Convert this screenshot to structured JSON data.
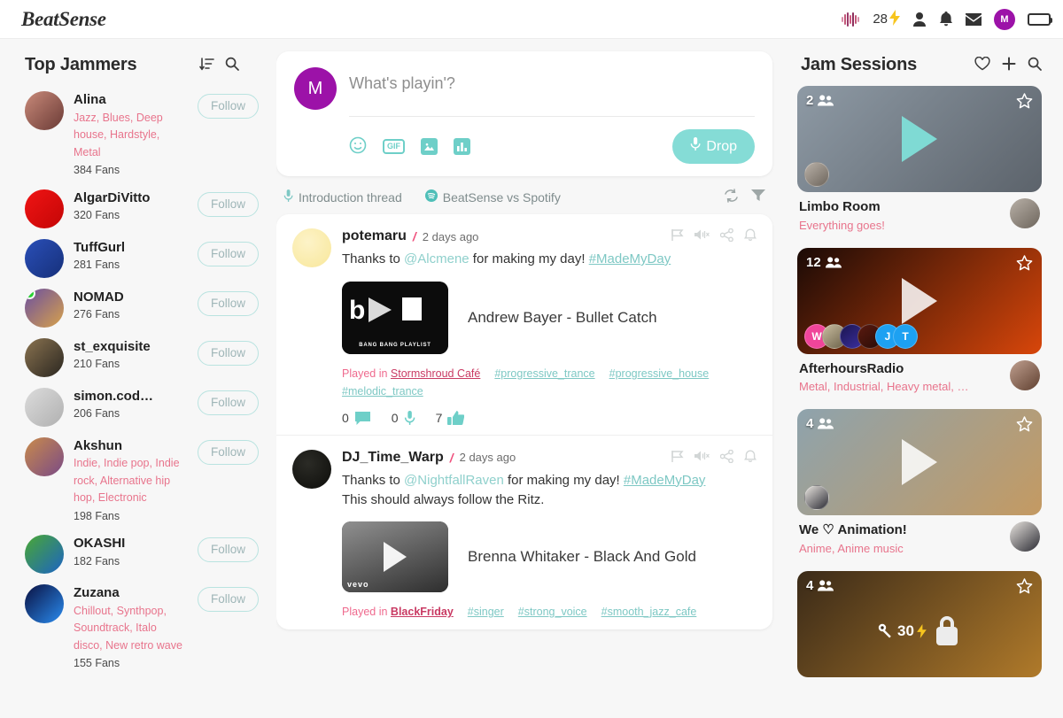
{
  "topbar": {
    "brand": "BeatSense",
    "points": "28",
    "icons": [
      "waveform-icon",
      "lightning-icon",
      "person-icon",
      "bell-icon",
      "envelope-icon",
      "battery-icon"
    ],
    "avatar_letter": "M"
  },
  "left": {
    "title": "Top Jammers",
    "sort_icon": "sort-descending-icon",
    "search_icon": "search-icon",
    "follow_label": "Follow",
    "jammers": [
      {
        "name": "Alina",
        "genres": "Jazz, Blues, Deep house, Hardstyle, Metal",
        "fans": "384 Fans",
        "online": false,
        "av1": "#c98a7a",
        "av2": "#6a3a35"
      },
      {
        "name": "AlgarDiVitto",
        "genres": "",
        "fans": "320 Fans",
        "online": false,
        "av1": "#f01414",
        "av2": "#c40606"
      },
      {
        "name": "TuffGurl",
        "genres": "",
        "fans": "281 Fans",
        "online": false,
        "av1": "#2a4fb8",
        "av2": "#16307a"
      },
      {
        "name": "NOMAD",
        "genres": "",
        "fans": "276 Fans",
        "online": true,
        "av1": "#6b4fa0",
        "av2": "#d8a24a"
      },
      {
        "name": "st_exquisite",
        "genres": "",
        "fans": "210 Fans",
        "online": false,
        "av1": "#8a7350",
        "av2": "#2a2620"
      },
      {
        "name": "simon.cod…",
        "genres": "",
        "fans": "206 Fans",
        "online": false,
        "av1": "#dcdcdc",
        "av2": "#b0b0b0"
      },
      {
        "name": "Akshun",
        "genres": "Indie, Indie pop, Indie rock, Alternative hip hop, Electronic",
        "fans": "198 Fans",
        "online": false,
        "av1": "#c98b4b",
        "av2": "#7a4a86"
      },
      {
        "name": "OKASHI",
        "genres": "",
        "fans": "182 Fans",
        "online": false,
        "av1": "#4aa832",
        "av2": "#1c63c4"
      },
      {
        "name": "Zuzana",
        "genres": "Chillout, Synthpop, Soundtrack, Italo disco, New retro wave",
        "fans": "155 Fans",
        "online": false,
        "av1": "#0a1040",
        "av2": "#2a8cf0"
      }
    ]
  },
  "composer": {
    "avatar_letter": "M",
    "placeholder": "What's playin'?",
    "value": "",
    "tools": [
      "emoji-icon",
      "gif-icon",
      "image-icon",
      "poll-icon"
    ],
    "gif_label": "GIF",
    "drop_label": "Drop"
  },
  "tabs": {
    "items": [
      {
        "label": "Introduction thread",
        "icon": "microphone-icon"
      },
      {
        "label": "BeatSense vs Spotify",
        "icon": "spotify-icon"
      }
    ],
    "refresh_icon": "refresh-icon",
    "filter_icon": "filter-icon"
  },
  "feed": {
    "action_icons": [
      "flag-icon",
      "mute-icon",
      "share-icon",
      "bell-icon"
    ],
    "posts": [
      {
        "user": "potemaru",
        "separator": "/",
        "time": "2 days ago",
        "text_pre": "Thanks to ",
        "mention": "@Alcmene",
        "text_mid": " for making my day! ",
        "hashtag": "#MadeMyDay",
        "text_extra": "",
        "track": "Andrew Bayer - Bullet Catch",
        "thumb_label": "BANG BANG PLAYLIST",
        "played_label": "Played in",
        "played_room": "Stormshroud Café",
        "tags": [
          "#progressive_trance",
          "#progressive_house",
          "#melodic_trance"
        ],
        "comments": "0",
        "voice": "0",
        "likes": "7"
      },
      {
        "user": "DJ_Time_Warp",
        "separator": "/",
        "time": "2 days ago",
        "text_pre": "Thanks to ",
        "mention": "@NightfallRaven",
        "text_mid": " for making my day! ",
        "hashtag": "#MadeMyDay",
        "text_extra": "This should always follow the Ritz.",
        "track": "Brenna Whitaker - Black And Gold",
        "thumb_label": "vevo",
        "played_label": "Played in",
        "played_room": "BlackFriday",
        "tags": [
          "#singer",
          "#strong_voice",
          "#smooth_jazz_cafe"
        ],
        "comments": "",
        "voice": "",
        "likes": ""
      }
    ]
  },
  "right": {
    "title": "Jam Sessions",
    "icons": [
      "heart-icon",
      "plus-icon",
      "search-icon"
    ],
    "sessions": [
      {
        "count": "2",
        "name": "Limbo Room",
        "desc": "Everything goes!",
        "play_color": "teal",
        "bg_a": "#8e9aa5",
        "bg_b": "#5c636b",
        "members": [
          {
            "type": "img",
            "c1": "#b9b1a8",
            "c2": "#6d655c"
          }
        ],
        "locked": false
      },
      {
        "count": "12",
        "name": "AfterhoursRadio",
        "desc": "Metal, Industrial, Heavy metal, Ha…",
        "play_color": "white",
        "bg_a": "#1a0a06",
        "bg_b": "#d8460a",
        "members": [
          {
            "type": "letter",
            "label": "W",
            "bg": "#f0459a"
          },
          {
            "type": "img",
            "c1": "#c9bda0",
            "c2": "#6b6149"
          },
          {
            "type": "img",
            "c1": "#1b1550",
            "c2": "#3b2fa0"
          },
          {
            "type": "img",
            "c1": "#5a1a10",
            "c2": "#2a0c06"
          },
          {
            "type": "letter",
            "label": "J",
            "bg": "#1da1f2"
          },
          {
            "type": "letter",
            "label": "T",
            "bg": "#1da1f2"
          }
        ],
        "locked": false
      },
      {
        "count": "4",
        "name": "We ♡ Animation!",
        "desc": "Anime, Anime music",
        "play_color": "white",
        "bg_a": "#8ea3ad",
        "bg_b": "#c49a62",
        "members": [
          {
            "type": "img",
            "c1": "#e8e4df",
            "c2": "#2b2b33"
          }
        ],
        "locked": false
      },
      {
        "count": "4",
        "name": "",
        "desc": "",
        "play_color": "white",
        "bg_a": "#3a2a18",
        "bg_b": "#b07a2a",
        "members": [],
        "locked": true,
        "key_price": "30"
      }
    ]
  }
}
